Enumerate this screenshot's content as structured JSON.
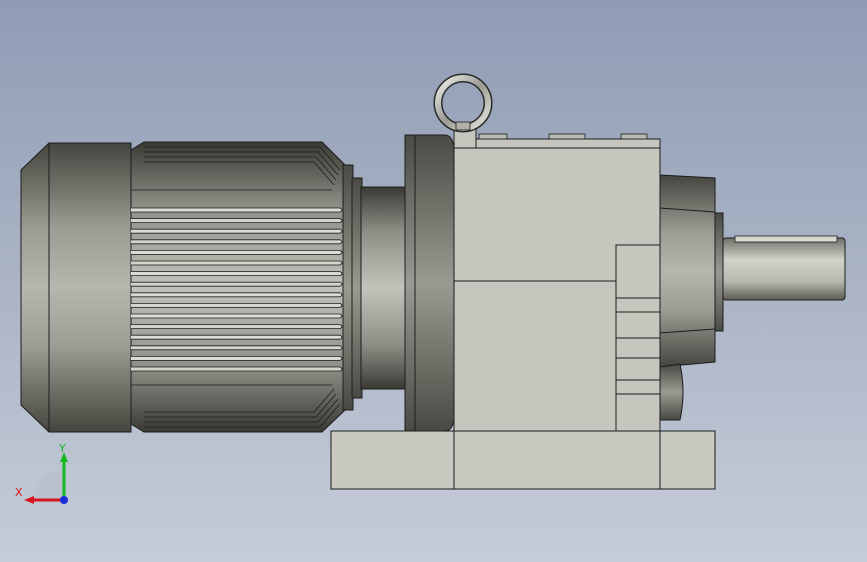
{
  "viewport": {
    "background_top": "#8f9cb4",
    "background_bottom": "#c6ccd8"
  },
  "model": {
    "body_color": "#c5c5bd",
    "edge_color": "#1c1c1c"
  },
  "triad": {
    "x_label": "X",
    "y_label": "Y",
    "x_color": "#d8141c",
    "y_color": "#18b820",
    "z_color": "#1c2cd8"
  }
}
